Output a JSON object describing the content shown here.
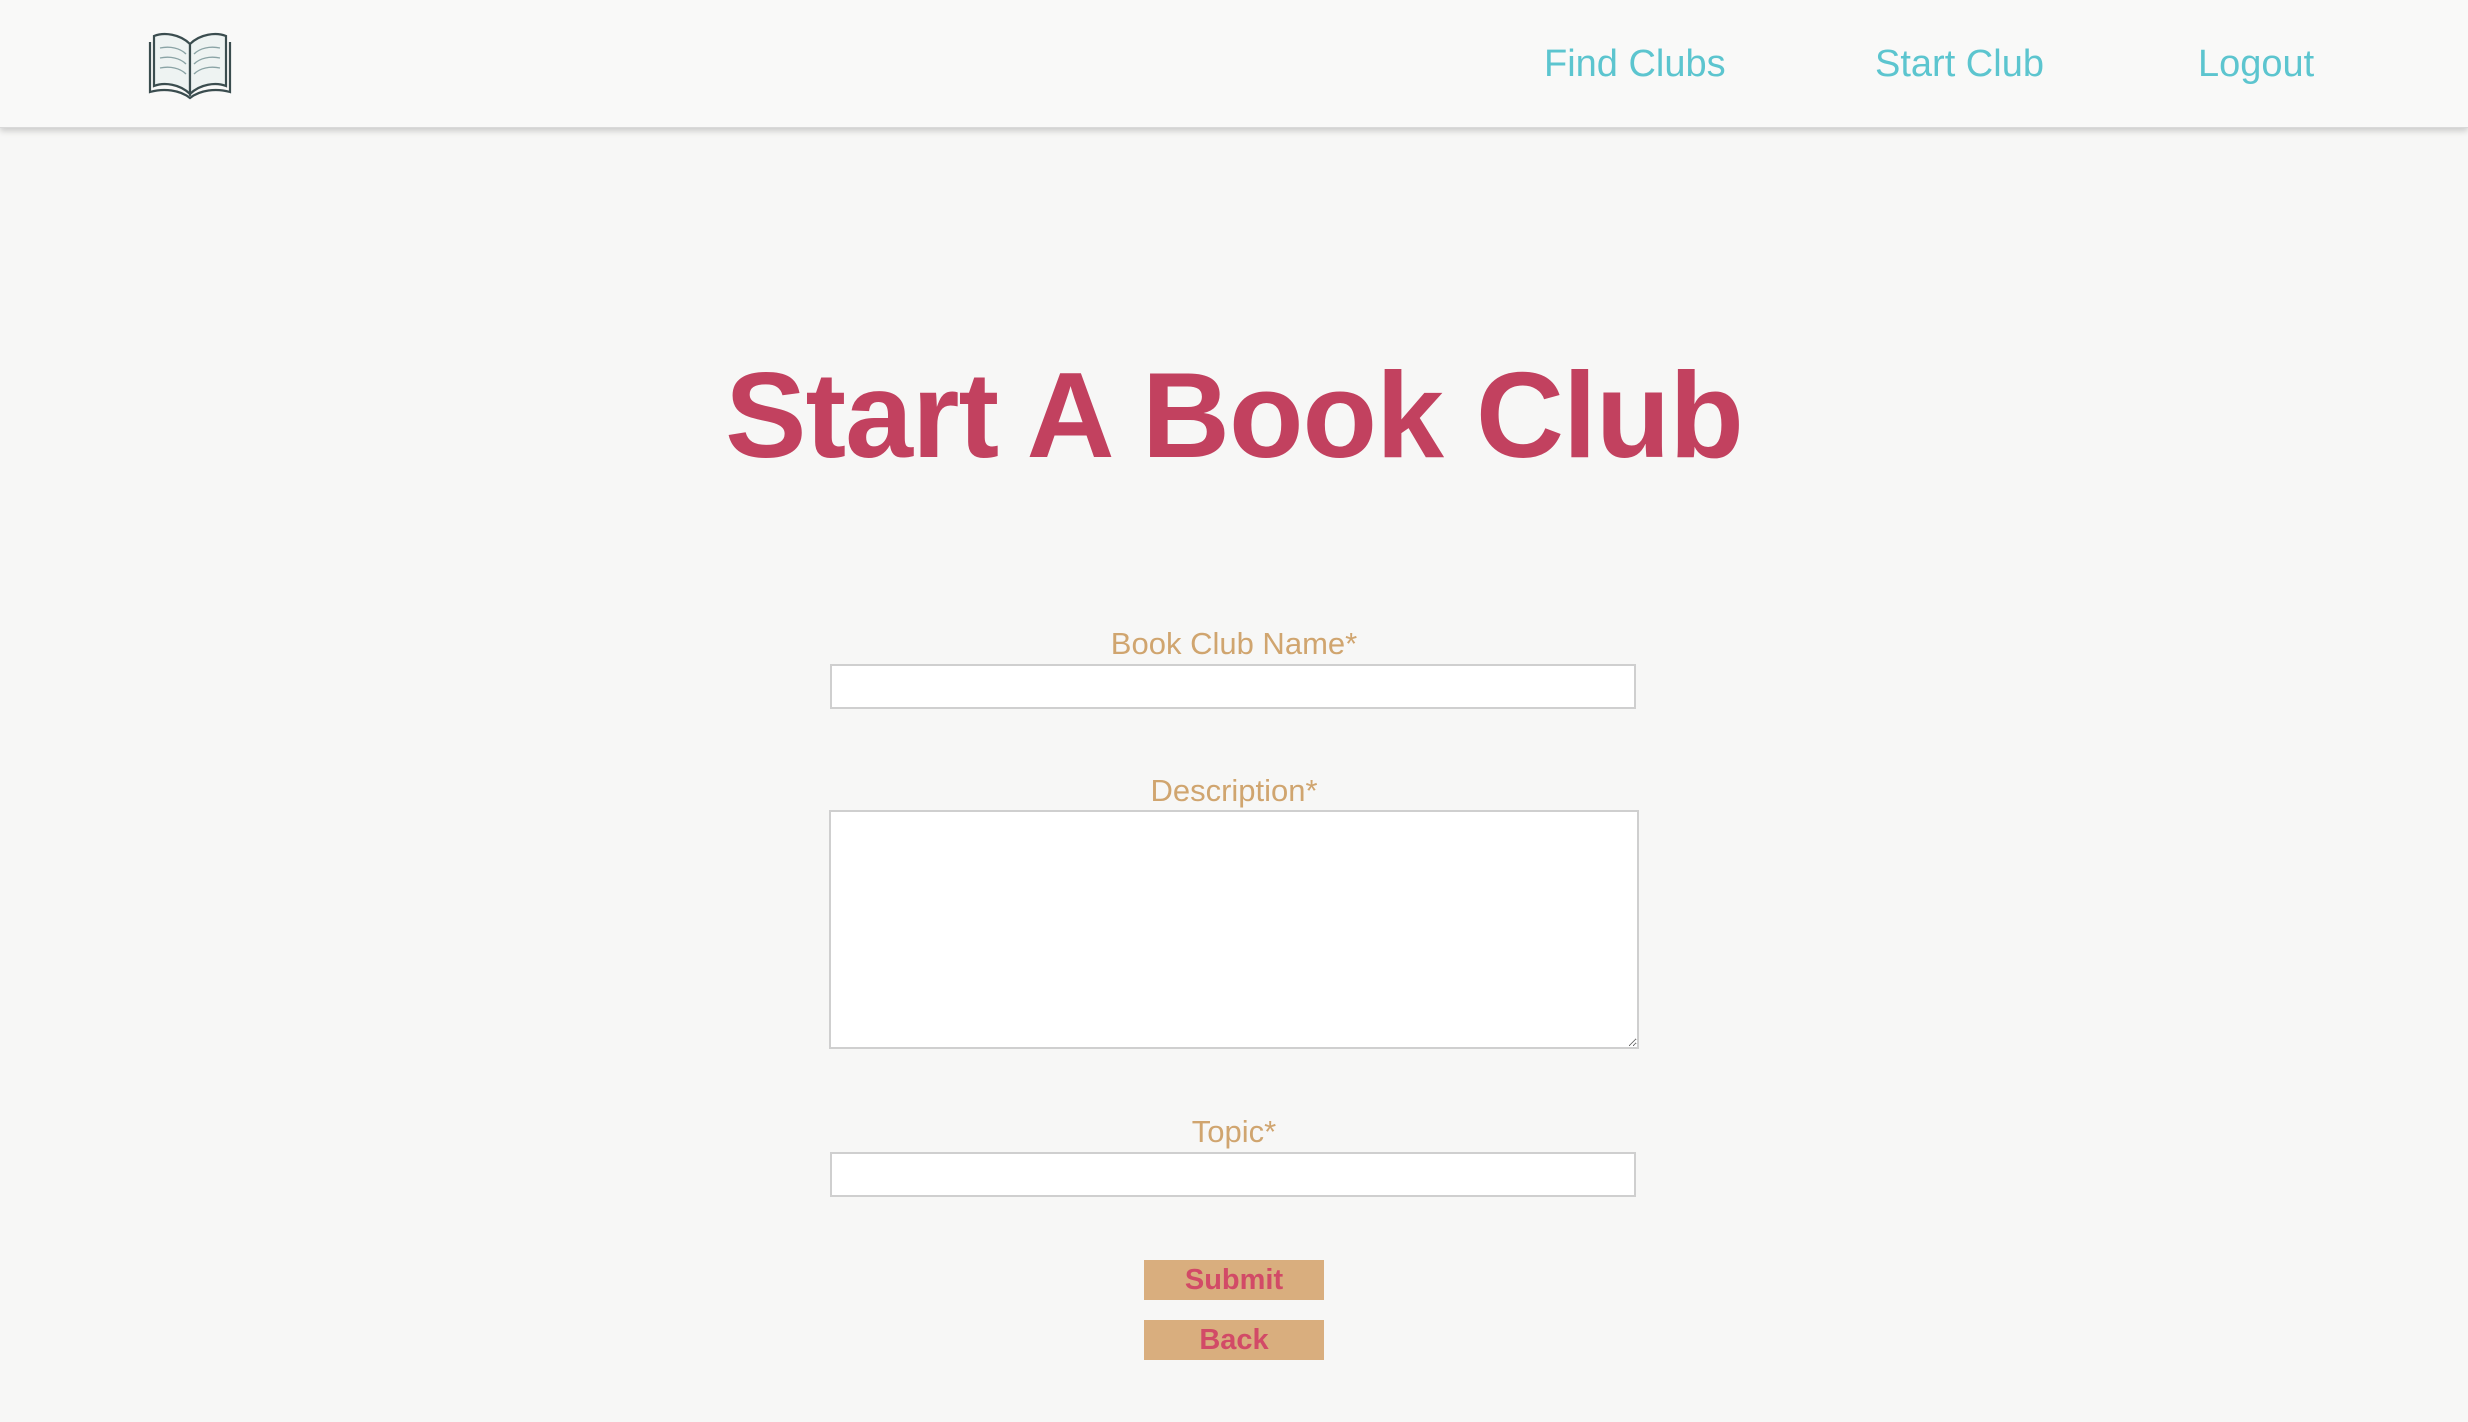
{
  "header": {
    "logo_icon": "open-book-icon",
    "nav": [
      {
        "label": "Find Clubs"
      },
      {
        "label": "Start Club"
      },
      {
        "label": "Logout"
      }
    ]
  },
  "main": {
    "title": "Start A Book Club",
    "form": {
      "name_label": "Book Club Name*",
      "name_value": "",
      "description_label": "Description*",
      "description_value": "",
      "topic_label": "Topic*",
      "topic_value": "",
      "submit_label": "Submit",
      "back_label": "Back"
    }
  },
  "colors": {
    "nav_link": "#5cc5cf",
    "title": "#c2415f",
    "label": "#d0a56f",
    "button_bg": "#d9ae7e",
    "button_text": "#d24a67"
  }
}
